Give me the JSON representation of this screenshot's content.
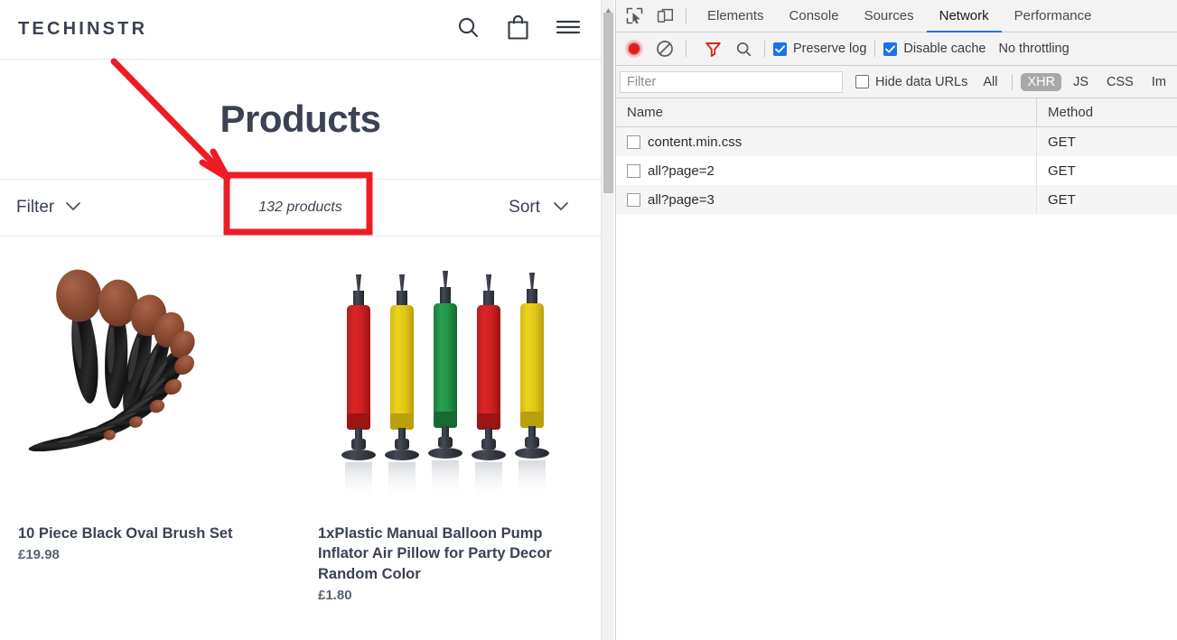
{
  "storefront": {
    "brand": "TECHINSTR",
    "header_icons": [
      {
        "name": "search-icon",
        "label": "Search"
      },
      {
        "name": "shopping-bag-icon",
        "label": "Cart"
      },
      {
        "name": "hamburger-menu-icon",
        "label": "Menu"
      }
    ],
    "page_title": "Products",
    "toolbar": {
      "filter_label": "Filter",
      "sort_label": "Sort",
      "product_count": "132 products"
    },
    "products": [
      {
        "title": "10 Piece Black Oval Brush Set",
        "price": "£19.98",
        "image": "oval-makeup-brush-set"
      },
      {
        "title": "1xPlastic Manual Balloon Pump Inflator Air Pillow for Party Decor Random Color",
        "price": "£1.80",
        "image": "balloon-hand-pumps"
      }
    ]
  },
  "annotation": {
    "color": "#ee1c25",
    "shapes": [
      "arrow",
      "rectangle-highlight"
    ],
    "target": "132 products"
  },
  "devtools": {
    "tabs": [
      {
        "label": "Elements",
        "active": false
      },
      {
        "label": "Console",
        "active": false
      },
      {
        "label": "Sources",
        "active": false
      },
      {
        "label": "Network",
        "active": true
      },
      {
        "label": "Performance",
        "active": false
      }
    ],
    "tab_icons": [
      {
        "name": "inspect-element-icon"
      },
      {
        "name": "device-toolbar-icon"
      }
    ],
    "network_toolbar": {
      "record_button": "record-button",
      "clear_button": "clear-button",
      "filter_toggle": "filter-funnel-icon",
      "search_button": "search-icon",
      "preserve_log_label": "Preserve log",
      "preserve_log_checked": true,
      "disable_cache_label": "Disable cache",
      "disable_cache_checked": true,
      "throttling_label": "No throttling"
    },
    "filter_bar": {
      "filter_placeholder": "Filter",
      "filter_value": "",
      "hide_data_urls_label": "Hide data URLs",
      "hide_data_urls_checked": false,
      "types": [
        {
          "label": "All",
          "selected": false
        },
        {
          "label": "XHR",
          "selected": true
        },
        {
          "label": "JS",
          "selected": false
        },
        {
          "label": "CSS",
          "selected": false
        },
        {
          "label": "Im",
          "selected": false
        }
      ]
    },
    "table": {
      "columns": [
        "Name",
        "Method"
      ],
      "rows": [
        {
          "name": "content.min.css",
          "method": "GET"
        },
        {
          "name": "all?page=2",
          "method": "GET"
        },
        {
          "name": "all?page=3",
          "method": "GET"
        }
      ]
    }
  },
  "colors": {
    "annotation_red": "#ee1c25",
    "devtools_accent": "#1a73e8",
    "text_dark": "#3b4252",
    "record_red": "#e02020"
  }
}
